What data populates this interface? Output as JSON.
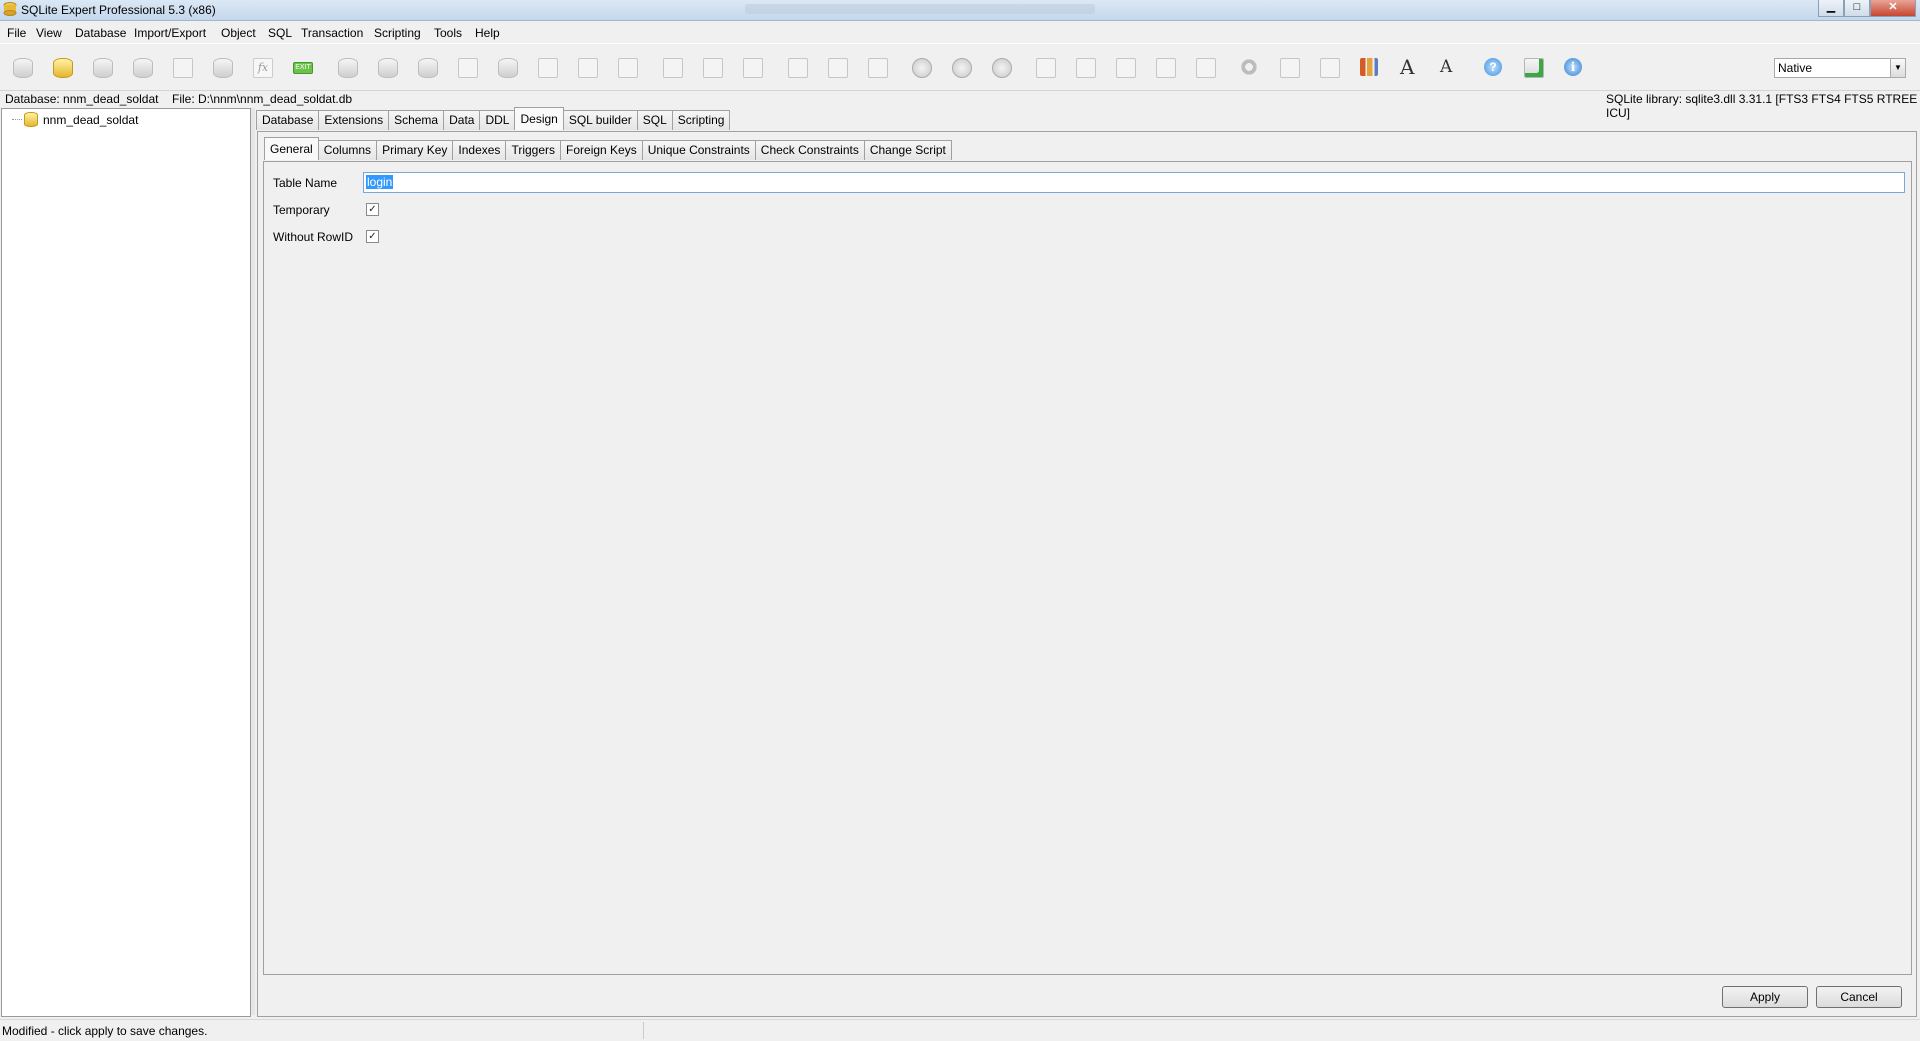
{
  "window": {
    "title": "SQLite Expert Professional 5.3 (x86)",
    "controls": {
      "minimize": "▁",
      "maximize": "□",
      "close": "✕"
    }
  },
  "menu": [
    "File",
    "View",
    "Database",
    "Import/Export",
    "Object",
    "SQL",
    "Transaction",
    "Scripting",
    "Tools",
    "Help"
  ],
  "toolbar": {
    "icons": [
      "database-icon",
      "open-database-icon",
      "attach-database-icon",
      "detach-database-icon",
      "rename-icon",
      "vacuum-icon",
      "function-icon",
      "exit-icon",
      "refresh-icon",
      "new-table-icon",
      "edit-table-icon",
      "drop-table-icon",
      "new-view-icon",
      "edit-view-icon",
      "new-index-icon",
      "import-icon",
      "table-icon",
      "delete-table-icon",
      "blank-page-icon",
      "edit-data-icon",
      "sql-icon",
      "sql-run-icon",
      "play-icon",
      "stop-icon",
      "back-icon",
      "script-icon",
      "script-edit-icon",
      "script-run-icon",
      "script-save-icon",
      "script-load-icon",
      "settings-gear-icon",
      "copy-icon",
      "paste-icon",
      "chart-icon",
      "increase-font-icon",
      "decrease-font-icon",
      "help-icon",
      "export-icon",
      "info-icon"
    ],
    "font_increase": "A",
    "font_decrease": "A",
    "help_glyph": "?",
    "info_glyph": "i",
    "exit_glyph": "EXIT",
    "fx_glyph": "fx",
    "encoding_select": "Native"
  },
  "info": {
    "database": "Database: nnm_dead_soldat",
    "file": "File: D:\\nnm\\nnm_dead_soldat.db",
    "library": "SQLite library: sqlite3.dll 3.31.1 [FTS3 FTS4 FTS5 RTREE ICU]"
  },
  "tree": {
    "root": "nnm_dead_soldat"
  },
  "main_tabs": [
    "Database",
    "Extensions",
    "Schema",
    "Data",
    "DDL",
    "Design",
    "SQL builder",
    "SQL",
    "Scripting"
  ],
  "main_active": "Design",
  "sub_tabs": [
    "General",
    "Columns",
    "Primary Key",
    "Indexes",
    "Triggers",
    "Foreign Keys",
    "Unique Constraints",
    "Check Constraints",
    "Change Script"
  ],
  "sub_active": "General",
  "form": {
    "table_name_label": "Table Name",
    "table_name_value": "login",
    "temporary_label": "Temporary",
    "temporary_checked": true,
    "without_rowid_label": "Without RowID",
    "without_rowid_checked": true,
    "check_mark": "✓"
  },
  "buttons": {
    "apply": "Apply",
    "cancel": "Cancel"
  },
  "status": "Modified - click apply to save changes."
}
